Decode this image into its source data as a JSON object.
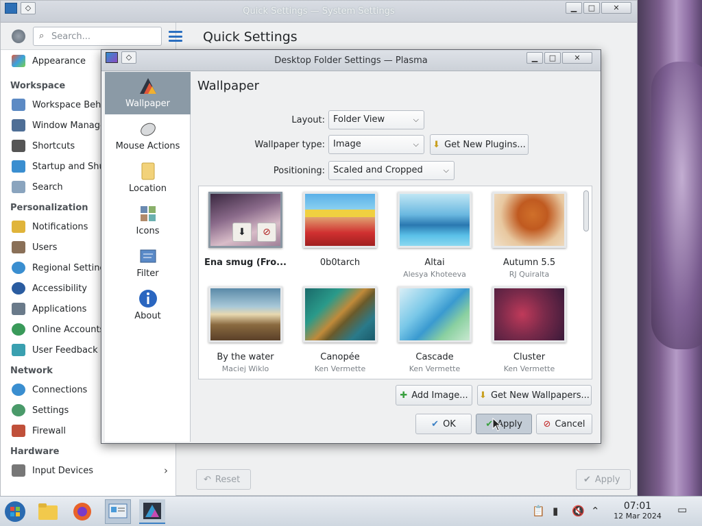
{
  "system_window": {
    "title": "Quick Settings — System Settings",
    "search_placeholder": "Search...",
    "main_title": "Quick Settings",
    "reset_label": "Reset",
    "apply_label": "Apply",
    "sidebar": {
      "top_item": "Appearance",
      "sections": [
        {
          "title": "Workspace",
          "items": [
            "Workspace Behavior",
            "Window Management",
            "Shortcuts",
            "Startup and Shutdown",
            "Search"
          ]
        },
        {
          "title": "Personalization",
          "items": [
            "Notifications",
            "Users",
            "Regional Settings",
            "Accessibility",
            "Applications",
            "Online Accounts",
            "User Feedback"
          ]
        },
        {
          "title": "Network",
          "items": [
            "Connections",
            "Settings",
            "Firewall"
          ]
        },
        {
          "title": "Hardware",
          "items": [
            "Input Devices"
          ]
        }
      ]
    }
  },
  "dialog": {
    "title": "Desktop Folder Settings — Plasma",
    "nav": [
      {
        "label": "Wallpaper",
        "icon": "wallpaper-icon"
      },
      {
        "label": "Mouse Actions",
        "icon": "mouse-icon"
      },
      {
        "label": "Location",
        "icon": "folder-icon"
      },
      {
        "label": "Icons",
        "icon": "icons-icon"
      },
      {
        "label": "Filter",
        "icon": "filter-icon"
      },
      {
        "label": "About",
        "icon": "info-icon"
      }
    ],
    "heading": "Wallpaper",
    "layout_label": "Layout:",
    "layout_value": "Folder View",
    "type_label": "Wallpaper type:",
    "type_value": "Image",
    "get_plugins": "Get New Plugins...",
    "positioning_label": "Positioning:",
    "positioning_value": "Scaled and Cropped",
    "wallpapers": [
      {
        "name": "Ena smug (Fro...",
        "author": ""
      },
      {
        "name": "0b0tarch",
        "author": ""
      },
      {
        "name": "Altai",
        "author": "Alesya Khoteeva"
      },
      {
        "name": "Autumn 5.5",
        "author": "RJ Quiralta"
      },
      {
        "name": "By the water",
        "author": "Maciej Wiklo"
      },
      {
        "name": "Canopée",
        "author": "Ken Vermette"
      },
      {
        "name": "Cascade",
        "author": "Ken Vermette"
      },
      {
        "name": "Cluster",
        "author": "Ken Vermette"
      }
    ],
    "add_image": "Add Image...",
    "get_wallpapers": "Get New Wallpapers...",
    "ok": "OK",
    "apply": "Apply",
    "cancel": "Cancel"
  },
  "taskbar": {
    "time": "07:01",
    "date": "12 Mar 2024"
  },
  "colors": {
    "accent": "#2b6fc0",
    "selection": "#8b9aa6"
  }
}
